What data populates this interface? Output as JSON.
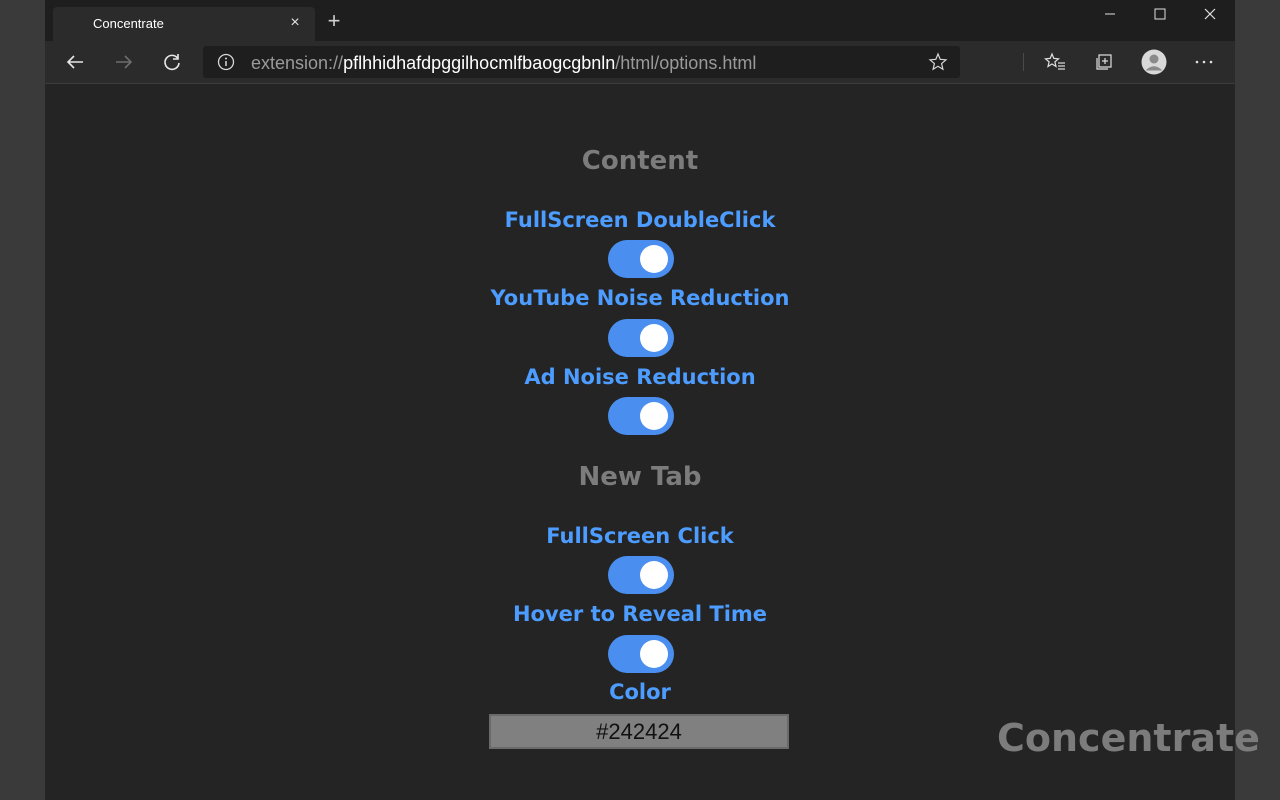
{
  "browser": {
    "tab_title": "Concentrate",
    "tab_close": "×",
    "new_tab": "+",
    "url_scheme": "extension://",
    "url_host": "pflhhidhafdpggilhocmlfbaogcgbnln",
    "url_path": "/html/options.html"
  },
  "sections": [
    {
      "heading": "Content",
      "options": [
        {
          "label": "FullScreen DoubleClick",
          "enabled": true
        },
        {
          "label": "YouTube Noise Reduction",
          "enabled": true
        },
        {
          "label": "Ad Noise Reduction",
          "enabled": true
        }
      ]
    },
    {
      "heading": "New Tab",
      "options": [
        {
          "label": "FullScreen Click",
          "enabled": true
        },
        {
          "label": "Hover to Reveal Time",
          "enabled": true
        },
        {
          "label": "Color"
        }
      ]
    }
  ],
  "color_value": "#242424",
  "brand": "Concentrate",
  "colors": {
    "accent": "#4d9cff",
    "toggle_on": "#4a8ff0",
    "heading": "#7c7c7c",
    "background": "#242424"
  },
  "icons": [
    "back-icon",
    "forward-icon",
    "refresh-icon",
    "info-icon",
    "star-icon",
    "favorites-icon",
    "collections-icon",
    "profile-icon",
    "more-icon",
    "minimize-icon",
    "maximize-icon",
    "close-icon"
  ]
}
